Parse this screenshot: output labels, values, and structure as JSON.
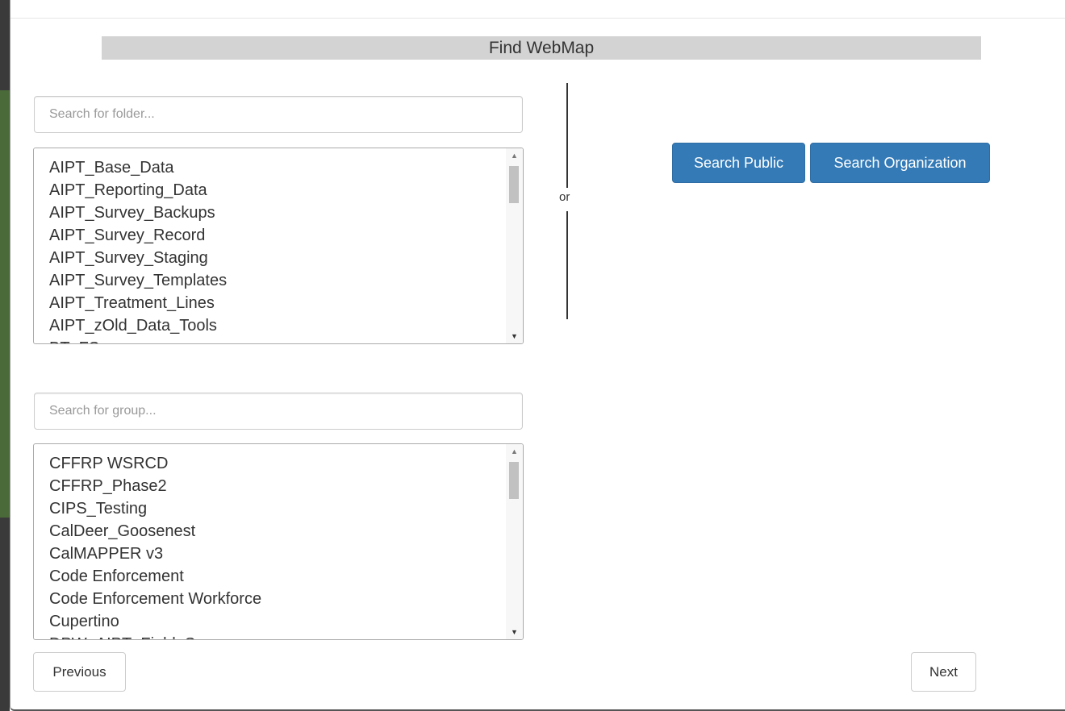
{
  "dialog": {
    "title": "Find WebMap"
  },
  "folder_search": {
    "placeholder": "Search for folder..."
  },
  "folders": {
    "items": [
      "AIPT_Base_Data",
      "AIPT_Reporting_Data",
      "AIPT_Survey_Backups",
      "AIPT_Survey_Record",
      "AIPT_Survey_Staging",
      "AIPT_Survey_Templates",
      "AIPT_Treatment_Lines",
      "AIPT_zOld_Data_Tools",
      "BT_FS"
    ]
  },
  "group_search": {
    "placeholder": "Search for group..."
  },
  "groups": {
    "items": [
      "CFFRP WSRCD",
      "CFFRP_Phase2",
      "CIPS_Testing",
      "CalDeer_Goosenest",
      "CalMAPPER v3",
      "Code Enforcement",
      "Code Enforcement Workforce",
      "Cupertino",
      "DPW_AIPT_Field_Survey"
    ]
  },
  "separator": {
    "label": "or"
  },
  "actions": {
    "search_public": "Search Public",
    "search_organization": "Search Organization",
    "previous": "Previous",
    "next": "Next"
  },
  "colors": {
    "primary": "#337ab7",
    "title_bar": "#d3d3d3"
  },
  "icons": {
    "scroll_up": "triangle-up",
    "scroll_down": "triangle-down"
  }
}
